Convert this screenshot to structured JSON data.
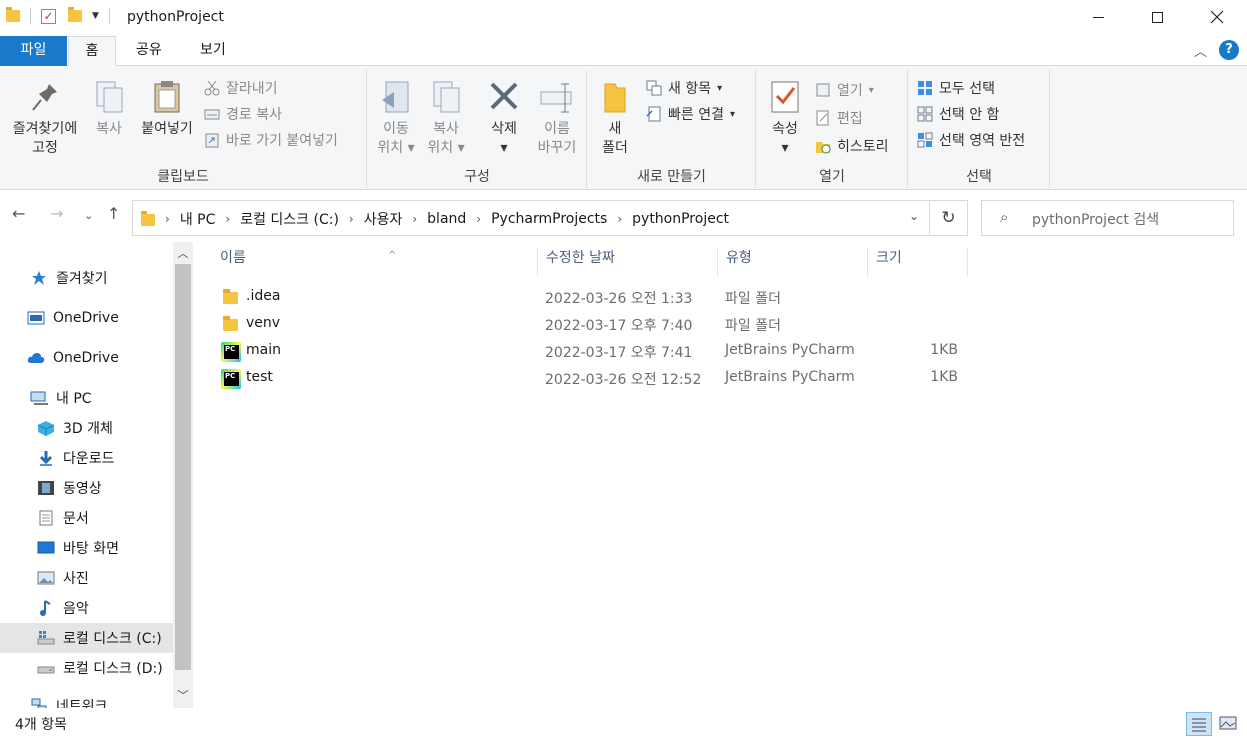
{
  "window": {
    "title": "pythonProject"
  },
  "ribbon_tabs": [
    "파일",
    "홈",
    "공유",
    "보기"
  ],
  "ribbon": {
    "clipboard": {
      "label": "클립보드",
      "pin_line1": "즐겨찾기에",
      "pin_line2": "고정",
      "copy": "복사",
      "paste": "붙여넣기",
      "cut": "잘라내기",
      "copy_path": "경로 복사",
      "paste_shortcut": "바로 가기 붙여넣기"
    },
    "organize": {
      "label": "구성",
      "move_line1": "이동",
      "move_line2": "위치",
      "copyto_line1": "복사",
      "copyto_line2": "위치",
      "delete": "삭제",
      "rename_line1": "이름",
      "rename_line2": "바꾸기"
    },
    "new": {
      "label": "새로 만들기",
      "folder_line1": "새",
      "folder_line2": "폴더",
      "new_item": "새 항목",
      "easy_access": "빠른 연결"
    },
    "open": {
      "label": "열기",
      "properties": "속성",
      "open": "열기",
      "edit": "편집",
      "history": "히스토리"
    },
    "select": {
      "label": "선택",
      "select_all": "모두 선택",
      "select_none": "선택 안 함",
      "invert": "선택 영역 반전"
    }
  },
  "address": {
    "crumbs": [
      "내 PC",
      "로컬 디스크 (C:)",
      "사용자",
      "bland",
      "PycharmProjects",
      "pythonProject"
    ]
  },
  "search": {
    "placeholder": "pythonProject 검색"
  },
  "navpane": {
    "items": [
      {
        "label": "즐겨찾기",
        "icon": "star-icon"
      },
      {
        "label": "OneDrive",
        "icon": "onedrive-box-icon"
      },
      {
        "label": "OneDrive",
        "icon": "cloud-icon"
      },
      {
        "label": "내 PC",
        "icon": "computer-icon"
      },
      {
        "label": "3D 개체",
        "icon": "cube-icon"
      },
      {
        "label": "다운로드",
        "icon": "download-arrow-icon"
      },
      {
        "label": "동영상",
        "icon": "film-icon"
      },
      {
        "label": "문서",
        "icon": "document-icon"
      },
      {
        "label": "바탕 화면",
        "icon": "desktop-icon"
      },
      {
        "label": "사진",
        "icon": "picture-icon"
      },
      {
        "label": "음악",
        "icon": "music-note-icon"
      },
      {
        "label": "로컬 디스크 (C:)",
        "icon": "windows-drive-icon"
      },
      {
        "label": "로컬 디스크 (D:)",
        "icon": "drive-icon"
      },
      {
        "label": "네트워크",
        "icon": "network-icon"
      }
    ]
  },
  "columns": [
    "이름",
    "수정한 날짜",
    "유형",
    "크기"
  ],
  "files": [
    {
      "name": ".idea",
      "date": "2022-03-26 오전 1:33",
      "type": "파일 폴더",
      "size": "",
      "icon": "folder-icon"
    },
    {
      "name": "venv",
      "date": "2022-03-17 오후 7:40",
      "type": "파일 폴더",
      "size": "",
      "icon": "folder-icon"
    },
    {
      "name": "main",
      "date": "2022-03-17 오후 7:41",
      "type": "JetBrains PyCharm",
      "size": "1KB",
      "icon": "pycharm-file-icon"
    },
    {
      "name": "test",
      "date": "2022-03-26 오전 12:52",
      "type": "JetBrains PyCharm",
      "size": "1KB",
      "icon": "pycharm-file-icon"
    }
  ],
  "status": {
    "count": "4개 항목"
  },
  "colors": {
    "file_tab": "#1979ca",
    "ribbon_bg": "#f5f6f7",
    "selected_nav": "#e5e5e5",
    "header_text": "#4c607a"
  }
}
